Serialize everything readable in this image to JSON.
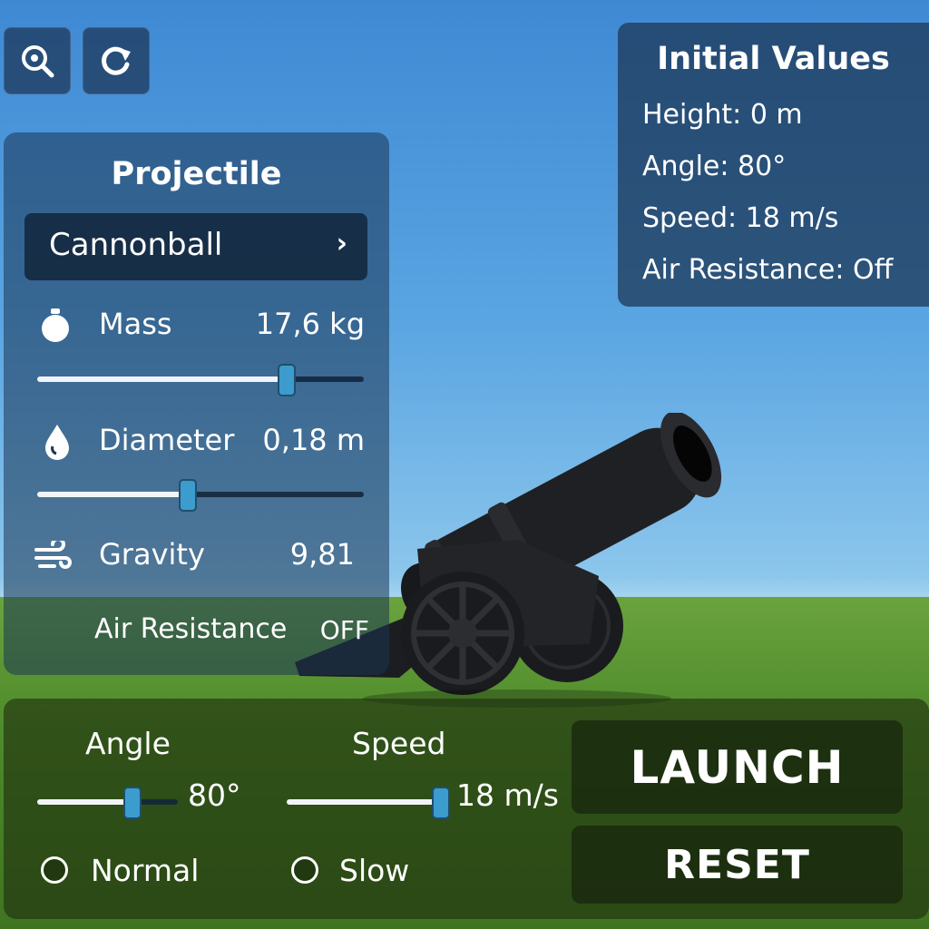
{
  "toolbar": {
    "zoom_icon": "zoom-in-icon",
    "refresh_icon": "refresh-icon"
  },
  "projectile_panel": {
    "title": "Projectile",
    "selected_projectile": "Cannonball",
    "mass": {
      "label": "Mass",
      "value": "17,6 kg",
      "level": 0.78
    },
    "diameter": {
      "label": "Diameter",
      "value": "0,18 m",
      "level": 0.46
    },
    "gravity": {
      "label": "Gravity",
      "value": "9,81"
    },
    "air_resistance": {
      "label": "Air Resistance",
      "value": "OFF"
    }
  },
  "initial_values": {
    "title": "Initial Values",
    "height": "Height:  0 m",
    "angle": "Angle:  80°",
    "speed": "Speed:  18 m/s",
    "air_resistance": "Air Resistance:  Off"
  },
  "controls": {
    "angle": {
      "label": "Angle",
      "value": "80°",
      "level": 0.7
    },
    "speed": {
      "label": "Speed",
      "value": "18 m/s",
      "level": 1.0
    },
    "normal_label": "Normal",
    "slow_label": "Slow",
    "launch_label": "LAUNCH",
    "reset_label": "RESET"
  },
  "colors": {
    "slider_thumb": "#3c9ccd",
    "panel_blue": "#1c3452",
    "panel_green": "#1e2e0e"
  }
}
